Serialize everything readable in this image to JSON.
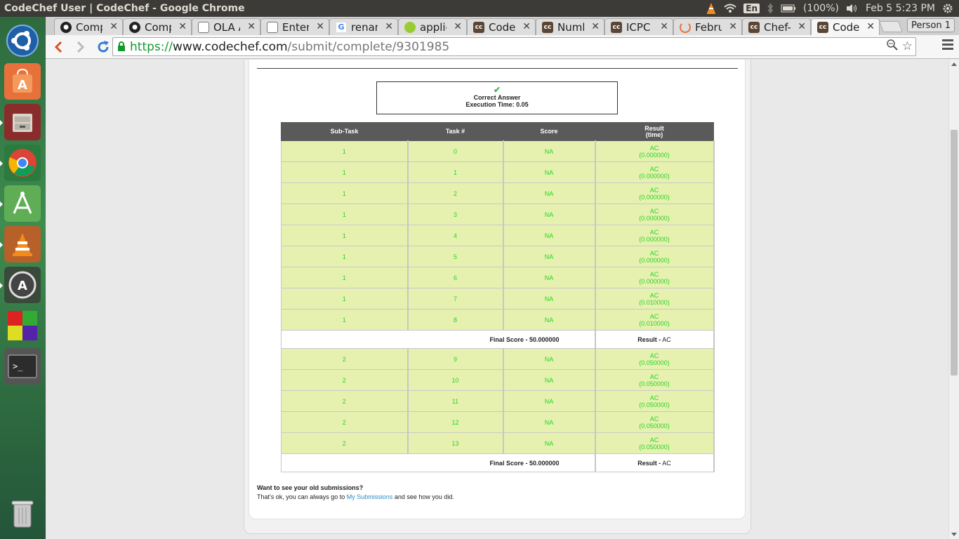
{
  "panel": {
    "window_title": "CodeChef User | CodeChef - Google Chrome",
    "keyboard_layout": "En",
    "battery": "(100%)",
    "datetime": "Feb  5  5:23 PM"
  },
  "launcher": {
    "items": [
      "ubuntu-dash-icon",
      "software-center-icon",
      "file-manager-icon",
      "chrome-icon",
      "android-studio-icon",
      "vlc-icon",
      "software-updater-icon",
      "workspaces-icon",
      "terminal-icon",
      "trash-icon"
    ]
  },
  "tabs": [
    {
      "label": "Compa",
      "icon": "github-icon"
    },
    {
      "label": "Compa",
      "icon": "github-icon"
    },
    {
      "label": "OLA A",
      "icon": "document-icon"
    },
    {
      "label": "Enterp",
      "icon": "document-icon"
    },
    {
      "label": "renam",
      "icon": "google-icon"
    },
    {
      "label": "applica",
      "icon": "android-icon"
    },
    {
      "label": "CodeC",
      "icon": "codechef-icon"
    },
    {
      "label": "Numb",
      "icon": "codechef-icon"
    },
    {
      "label": "ICPC P",
      "icon": "codechef-icon"
    },
    {
      "label": "Februa",
      "icon": "loading-icon"
    },
    {
      "label": "Chef-D",
      "icon": "codechef-icon"
    },
    {
      "label": "CodeC",
      "icon": "codechef-icon"
    }
  ],
  "profile": "Person 1",
  "url": {
    "scheme": "https://",
    "host": "www.codechef.com",
    "path": "/submit/complete/9301985"
  },
  "status": {
    "verdict": "Correct Answer",
    "execution_time": "Execution Time: 0.05",
    "verdict_color": "#4caf50"
  },
  "table": {
    "headers": [
      "Sub-Task",
      "Task #",
      "Score",
      "Result",
      "(time)"
    ],
    "subtask1_rows": [
      {
        "subtask": "1",
        "task": "0",
        "score": "NA",
        "result": "AC",
        "time": "(0.000000)"
      },
      {
        "subtask": "1",
        "task": "1",
        "score": "NA",
        "result": "AC",
        "time": "(0.000000)"
      },
      {
        "subtask": "1",
        "task": "2",
        "score": "NA",
        "result": "AC",
        "time": "(0.000000)"
      },
      {
        "subtask": "1",
        "task": "3",
        "score": "NA",
        "result": "AC",
        "time": "(0.000000)"
      },
      {
        "subtask": "1",
        "task": "4",
        "score": "NA",
        "result": "AC",
        "time": "(0.000000)"
      },
      {
        "subtask": "1",
        "task": "5",
        "score": "NA",
        "result": "AC",
        "time": "(0.000000)"
      },
      {
        "subtask": "1",
        "task": "6",
        "score": "NA",
        "result": "AC",
        "time": "(0.000000)"
      },
      {
        "subtask": "1",
        "task": "7",
        "score": "NA",
        "result": "AC",
        "time": "(0.010000)"
      },
      {
        "subtask": "1",
        "task": "8",
        "score": "NA",
        "result": "AC",
        "time": "(0.010000)"
      }
    ],
    "subtask1_final": {
      "score": "Final Score - 50.000000",
      "result_label": "Result -",
      "result": "AC"
    },
    "subtask2_rows": [
      {
        "subtask": "2",
        "task": "9",
        "score": "NA",
        "result": "AC",
        "time": "(0.050000)"
      },
      {
        "subtask": "2",
        "task": "10",
        "score": "NA",
        "result": "AC",
        "time": "(0.050000)"
      },
      {
        "subtask": "2",
        "task": "11",
        "score": "NA",
        "result": "AC",
        "time": "(0.050000)"
      },
      {
        "subtask": "2",
        "task": "12",
        "score": "NA",
        "result": "AC",
        "time": "(0.050000)"
      },
      {
        "subtask": "2",
        "task": "13",
        "score": "NA",
        "result": "AC",
        "time": "(0.050000)"
      }
    ],
    "subtask2_final": {
      "score": "Final Score - 50.000000",
      "result_label": "Result -",
      "result": "AC"
    },
    "row_color": "#e6f1b0",
    "accepted_color": "#2bd22b"
  },
  "footer": {
    "question": "Want to see your old submissions?",
    "text_before": "That's ok, you can always go to ",
    "link": "My Submissions",
    "text_after": " and see how you did."
  }
}
